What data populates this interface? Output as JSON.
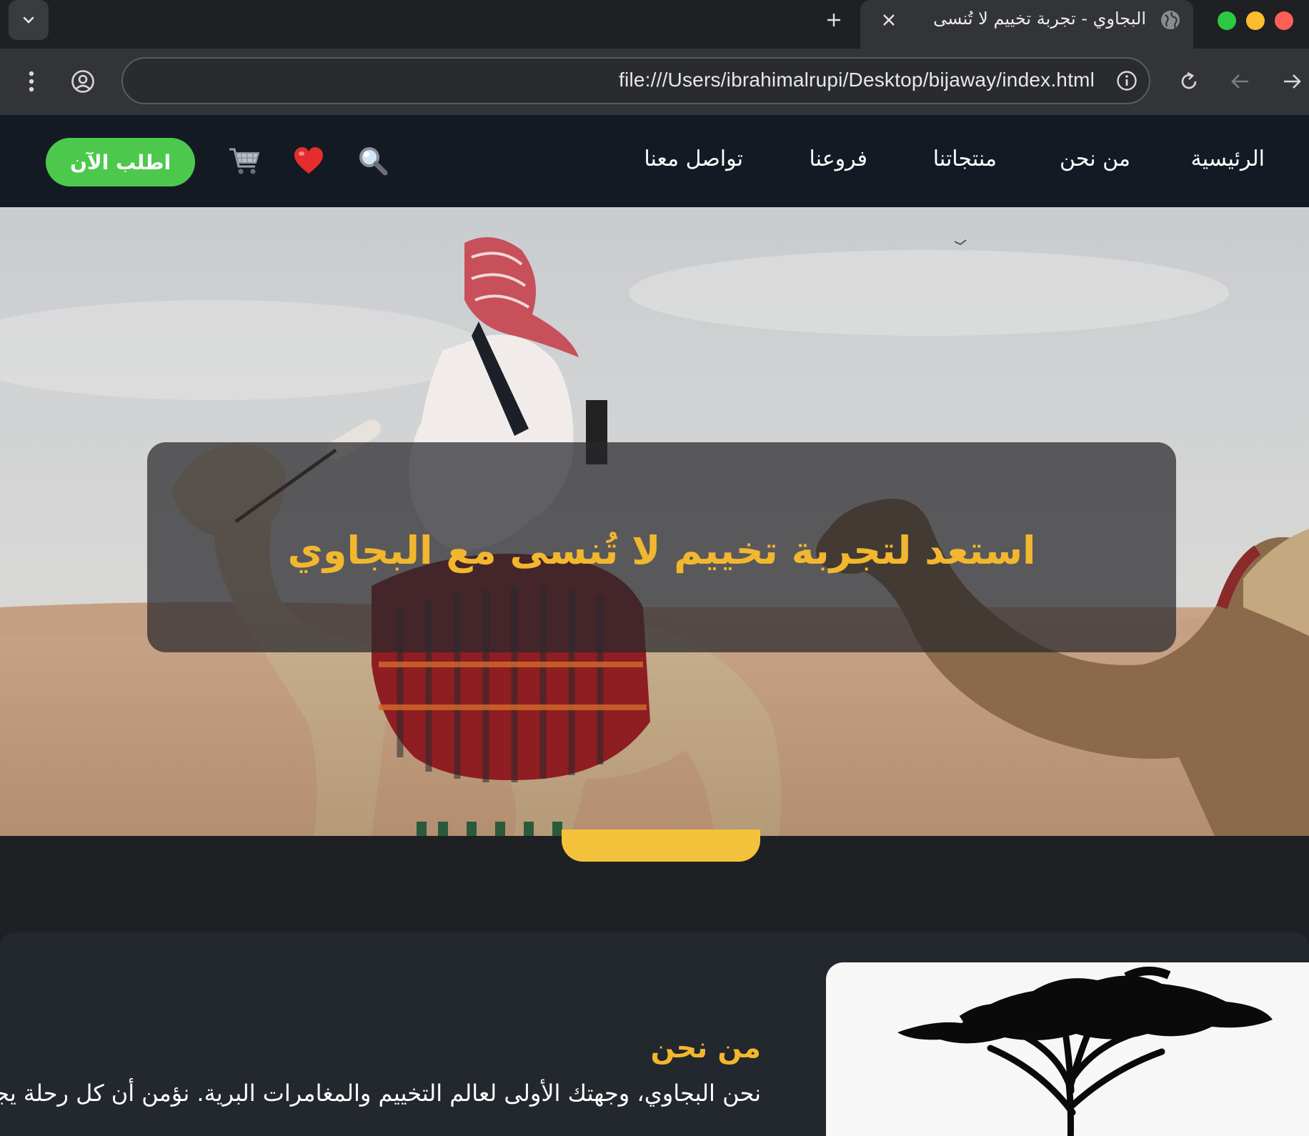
{
  "browser": {
    "tab_title": "البجاوي - تجربة تخييم لا تُنسى",
    "url": "file:///Users/ibrahimalrupi/Desktop/bijaway/index.html",
    "icons": [
      "chevron-down-icon",
      "plus-icon",
      "close-icon",
      "globe-icon",
      "more-vert-icon",
      "profile-icon",
      "info-icon",
      "reload-icon",
      "back-icon",
      "forward-icon"
    ]
  },
  "nav": {
    "links": [
      "الرئيسية",
      "من نحن",
      "منتجاتنا",
      "فروعنا",
      "تواصل معنا"
    ],
    "search_glyph": "🔍",
    "heart_glyph": "❤️",
    "cart_glyph": "🛒",
    "order_button": "اطلب الآن"
  },
  "hero": {
    "title": "استعد لتجربة تخييم لا تُنسى مع البجاوي"
  },
  "about": {
    "title": "من نحن",
    "text": "نحن البجاوي، وجهتك الأولى لعالم التخييم والمغامرات البرية. نؤمن أن كل رحلة يجب"
  },
  "colors": {
    "accent_gold": "#f2b72e",
    "order_green": "#4cc94c",
    "nav_bg": "#141a24"
  }
}
